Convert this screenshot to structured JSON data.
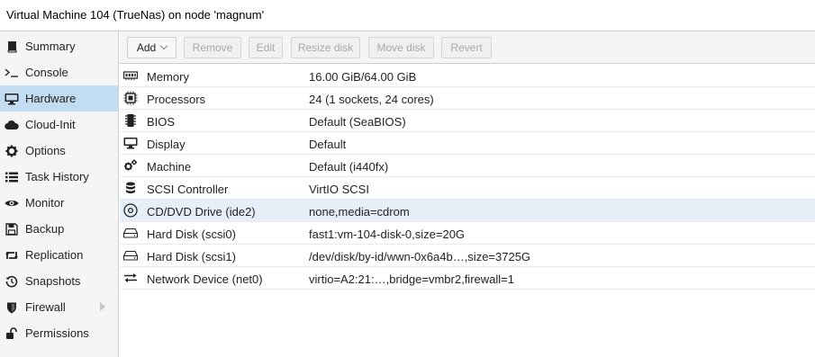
{
  "window": {
    "title": "Virtual Machine 104 (TrueNas) on node 'magnum'"
  },
  "colors": {
    "sidebar_active_bg": "#c2ddf2",
    "selected_row_bg": "#e6eff8",
    "sidebar_bg": "#f5f5f5"
  },
  "sidebar": {
    "active": "Hardware",
    "items": [
      {
        "label": "Summary",
        "icon": "book-icon"
      },
      {
        "label": "Console",
        "icon": "terminal-icon"
      },
      {
        "label": "Hardware",
        "icon": "desktop-icon"
      },
      {
        "label": "Cloud-Init",
        "icon": "cloud-icon"
      },
      {
        "label": "Options",
        "icon": "gear-icon"
      },
      {
        "label": "Task History",
        "icon": "list-icon"
      },
      {
        "label": "Monitor",
        "icon": "eye-icon"
      },
      {
        "label": "Backup",
        "icon": "floppy-icon"
      },
      {
        "label": "Replication",
        "icon": "retweet-icon"
      },
      {
        "label": "Snapshots",
        "icon": "history-icon"
      },
      {
        "label": "Firewall",
        "icon": "shield-icon"
      },
      {
        "label": "Permissions",
        "icon": "unlock-icon"
      }
    ]
  },
  "toolbar": {
    "add_label": "Add",
    "remove_label": "Remove",
    "edit_label": "Edit",
    "resize_label": "Resize disk",
    "move_label": "Move disk",
    "revert_label": "Revert"
  },
  "hardware": {
    "selected": "CD/DVD Drive (ide2)",
    "rows": [
      {
        "name": "Memory",
        "value": "16.00 GiB/64.00 GiB",
        "icon": "memory-icon"
      },
      {
        "name": "Processors",
        "value": "24 (1 sockets, 24 cores)",
        "icon": "cpu-icon"
      },
      {
        "name": "BIOS",
        "value": "Default (SeaBIOS)",
        "icon": "microchip-icon"
      },
      {
        "name": "Display",
        "value": "Default",
        "icon": "monitor-icon"
      },
      {
        "name": "Machine",
        "value": "Default (i440fx)",
        "icon": "cogs-icon"
      },
      {
        "name": "SCSI Controller",
        "value": "VirtIO SCSI",
        "icon": "database-icon"
      },
      {
        "name": "CD/DVD Drive (ide2)",
        "value": "none,media=cdrom",
        "icon": "cdrom-icon"
      },
      {
        "name": "Hard Disk (scsi0)",
        "value": "fast1:vm-104-disk-0,size=20G",
        "icon": "harddisk-icon"
      },
      {
        "name": "Hard Disk (scsi1)",
        "value": "/dev/disk/by-id/wwn-0x6a4b…,size=3725G",
        "icon": "harddisk-icon"
      },
      {
        "name": "Network Device (net0)",
        "value": "virtio=A2:21:…,bridge=vmbr2,firewall=1",
        "icon": "exchange-icon"
      }
    ]
  }
}
